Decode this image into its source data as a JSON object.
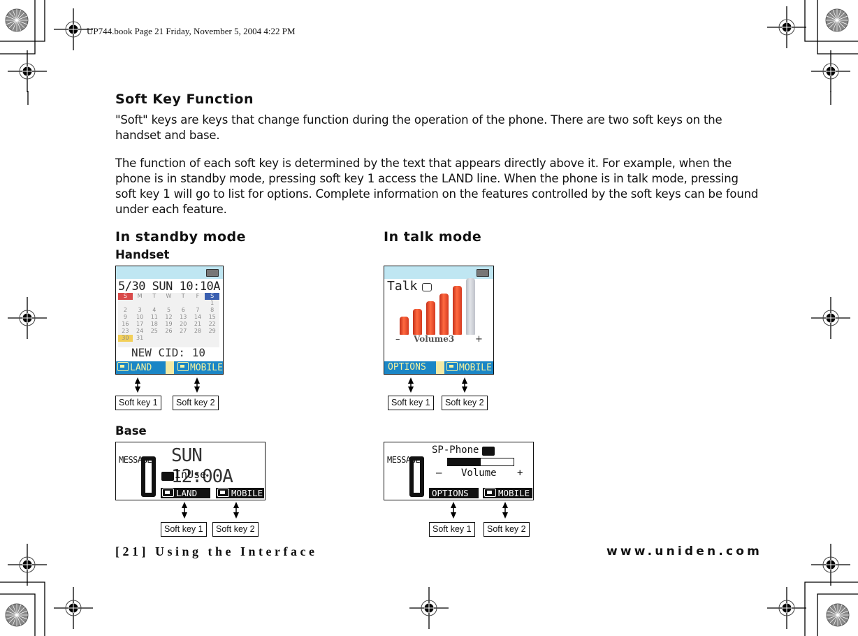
{
  "slug": "UP744.book  Page 21  Friday, November 5, 2004  4:22 PM",
  "section_title": "Soft Key Function",
  "paragraphs": [
    "\"Soft\" keys are keys that change function during the operation of the phone. There are two soft keys on the handset and base.",
    "The function of each soft key is determined by the text that appears directly above it. For example, when the phone is in standby mode, pressing soft key 1 access the LAND line. When the phone is in talk mode, pressing soft key 1 will go to list for options. Complete information on the features controlled by the soft keys can be found under each feature."
  ],
  "standby_heading": "In standby mode",
  "talk_heading": "In talk mode",
  "handset_label": "Handset",
  "base_label": "Base",
  "handset_standby": {
    "datetime": "5/30 SUN 10:10A",
    "calendar_days": [
      "S",
      "M",
      "T",
      "W",
      "T",
      "F",
      "S"
    ],
    "calendar_rows": [
      [
        "",
        "",
        "",
        "",
        "",
        "",
        "1"
      ],
      [
        "2",
        "3",
        "4",
        "5",
        "6",
        "7",
        "8"
      ],
      [
        "9",
        "10",
        "11",
        "12",
        "13",
        "14",
        "15"
      ],
      [
        "16",
        "17",
        "18",
        "19",
        "20",
        "21",
        "22"
      ],
      [
        "23",
        "24",
        "25",
        "26",
        "27",
        "28",
        "29"
      ],
      [
        "30",
        "31",
        "",
        "",
        "",
        "",
        ""
      ]
    ],
    "status": "NEW CID: 10",
    "softkey1": "LAND",
    "softkey2": "MOBILE",
    "softkey1_icon": "phone-icon",
    "softkey2_icon": "mobile-icon"
  },
  "handset_talk": {
    "title": "Talk",
    "volume_label": "Volume3",
    "volume_minus": "–",
    "volume_plus": "+",
    "volume_level": 5,
    "volume_max": 6,
    "softkey1": "OPTIONS",
    "softkey2": "MOBILE"
  },
  "base_standby": {
    "message_label": "MESSAGE",
    "message_count": "0",
    "datetime": "SUN 12:00A",
    "status": "InUse",
    "softkey1": "LAND",
    "softkey2": "MOBILE"
  },
  "base_talk": {
    "message_label": "MESSAGE",
    "message_count": "0",
    "title": "SP-Phone",
    "volume_label": "Volume",
    "volume_minus": "–",
    "volume_plus": "+",
    "volume_fraction": 0.5,
    "softkey1": "OPTIONS",
    "softkey2": "MOBILE"
  },
  "callouts": {
    "softkey1": "Soft key 1",
    "softkey2": "Soft key 2"
  },
  "footer": {
    "left": "[21] Using the Interface",
    "right": "www.uniden.com"
  }
}
